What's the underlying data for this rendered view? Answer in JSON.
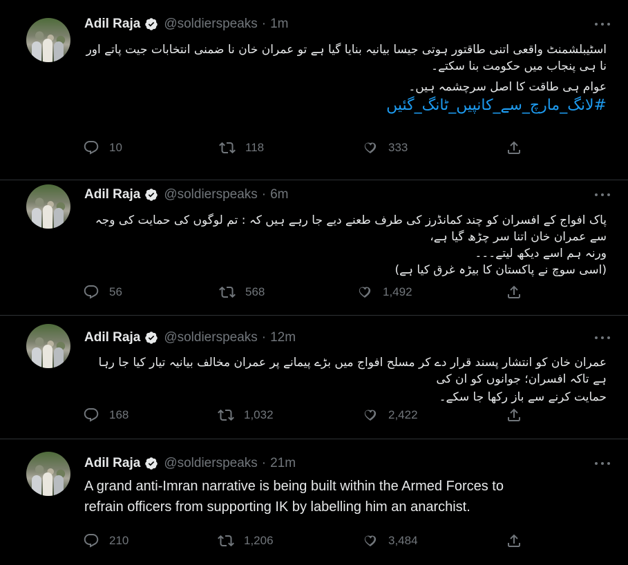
{
  "tweets": [
    {
      "name": "Adil Raja",
      "handle": "@soldierspeaks",
      "time": "1m",
      "lines": [
        "اسٹیبلشمنٹ واقعی اتنی طاقتور ہوتی جیسا بیانیہ بنایا گیا ہے تو عمران خان نا ضمنی انتخابات جیت پاتے اور نا ہی پنجاب میں حکومت بنا سکتے۔",
        "عوام ہی طاقت کا اصل سرچشمہ ہیں۔"
      ],
      "hashtag": "#لانگ_مارچ_سے_کانپیں_ٹانگ_گئیں",
      "replies": "10",
      "retweets": "118",
      "likes": "333"
    },
    {
      "name": "Adil Raja",
      "handle": "@soldierspeaks",
      "time": "6m",
      "lines": [
        "پاک افواج کے افسران کو چند کمانڈرز کی طرف طعنے دیے جا رہے ہیں کہ : تم لوگوں کی حمایت کی وجہ سے عمران خان اتنا سر چڑھ گیا ہے،",
        "ورنہ ہم اسے دیکھ لیتے۔۔۔",
        "(اسی سوچ نے پاکستان کا بیڑہ غرق کیا ہے)"
      ],
      "replies": "56",
      "retweets": "568",
      "likes": "1,492"
    },
    {
      "name": "Adil Raja",
      "handle": "@soldierspeaks",
      "time": "12m",
      "lines": [
        "عمران خان کو انتشار پسند قرار دے کر مسلح افواج میں بڑے پیمانے پر عمران مخالف بیانیہ تیار کیا جا رہا ہے تاکہ افسران؛ جوانوں کو ان کی",
        "حمایت کرنے سے باز رکھا جا سکے۔"
      ],
      "replies": "168",
      "retweets": "1,032",
      "likes": "2,422"
    },
    {
      "name": "Adil Raja",
      "handle": "@soldierspeaks",
      "time": "21m",
      "english_lines": [
        "A grand anti-Imran narrative is being built within the Armed Forces to",
        "refrain officers from supporting IK by labelling him an anarchist."
      ],
      "replies": "210",
      "retweets": "1,206",
      "likes": "3,484"
    }
  ],
  "dot": "·",
  "icons": {
    "verified": "verified-badge-icon",
    "reply": "reply-icon",
    "retweet": "retweet-icon",
    "like": "heart-icon",
    "share": "share-icon",
    "more": "more-icon"
  },
  "colors": {
    "background": "#000000",
    "text": "#e7e9ea",
    "muted": "#71767b",
    "hashtag": "#1d9bf0",
    "divider": "#2f3336"
  }
}
